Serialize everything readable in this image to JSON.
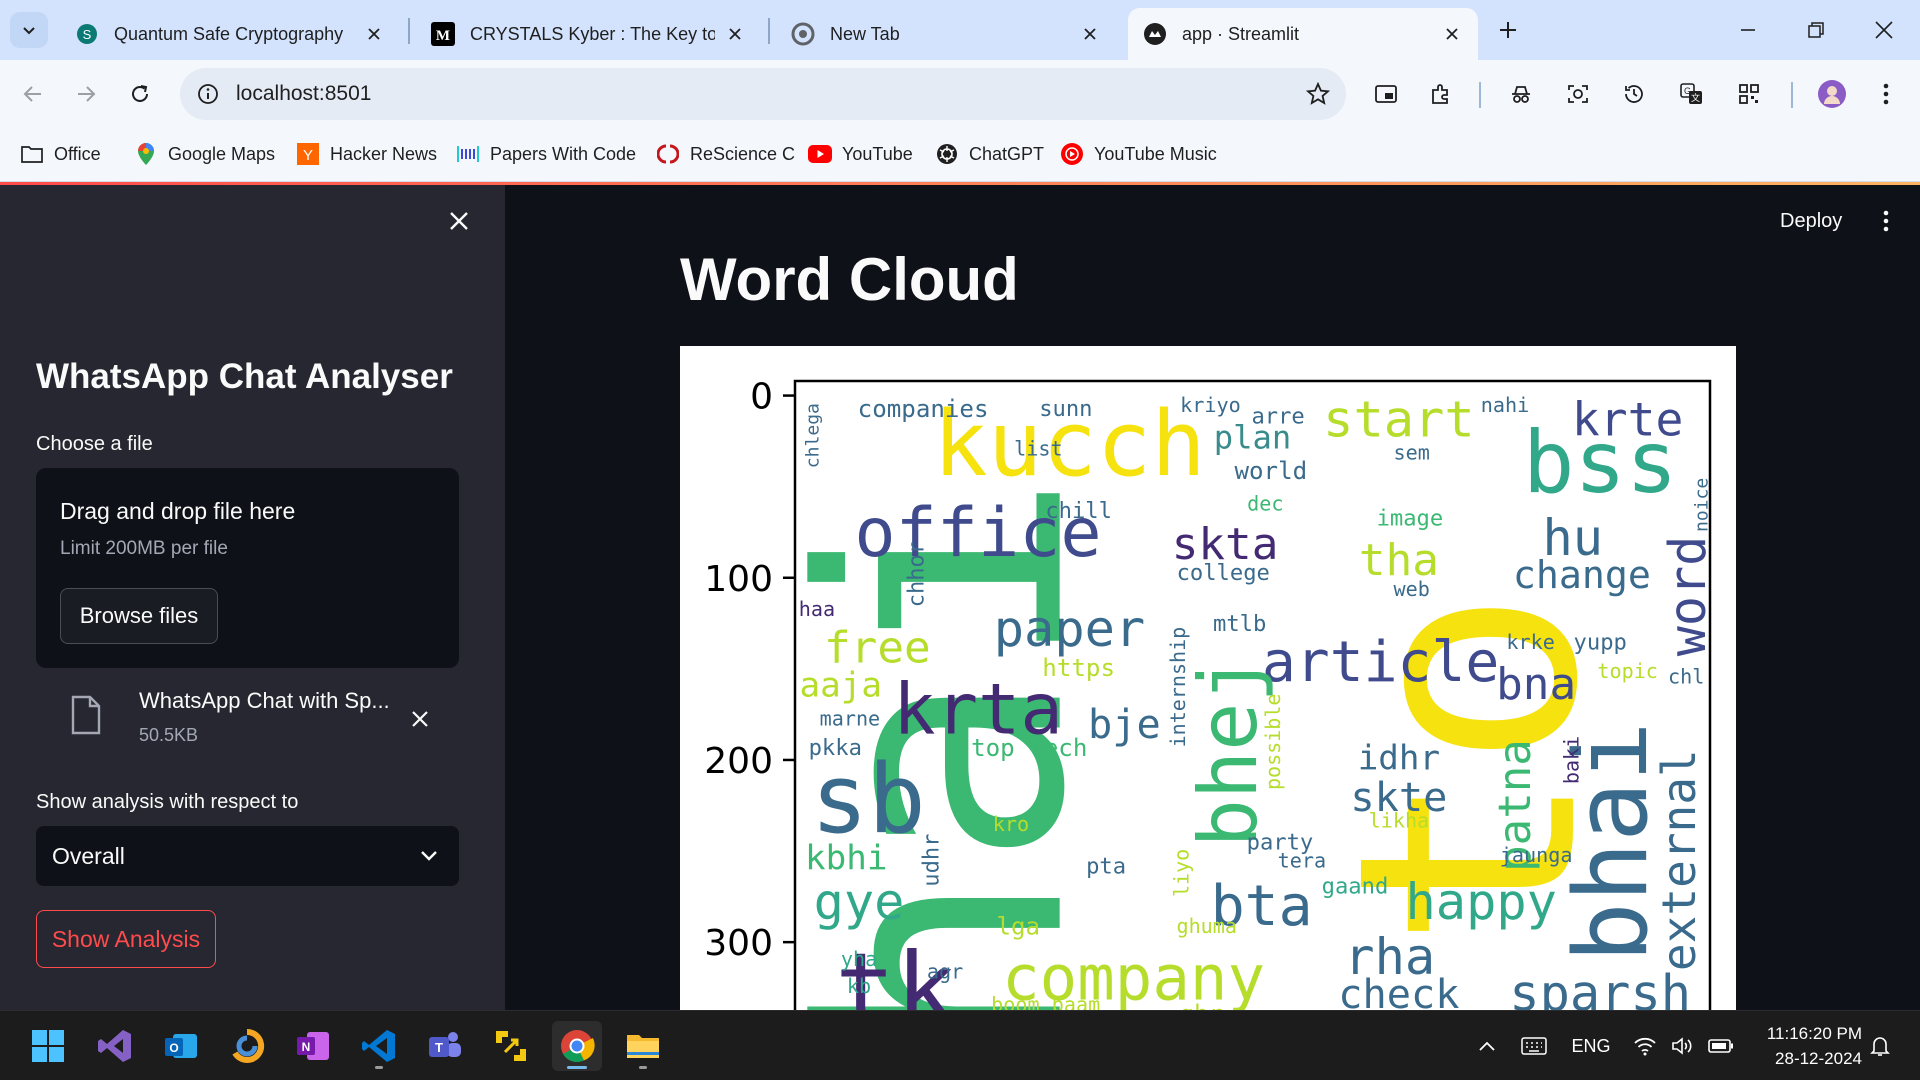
{
  "browser": {
    "tabs": [
      {
        "title": "Quantum Safe Cryptography",
        "favicon": "shield-s-icon"
      },
      {
        "title": "CRYSTALS Kyber : The Key to Po",
        "favicon": "medium-icon"
      },
      {
        "title": "New Tab",
        "favicon": "chrome-icon"
      },
      {
        "title": "app · Streamlit",
        "favicon": "streamlit-icon",
        "active": true
      }
    ],
    "url": "localhost:8501",
    "bookmarks": [
      {
        "label": "Office",
        "icon": "folder-icon"
      },
      {
        "label": "Google Maps",
        "icon": "maps-pin-icon"
      },
      {
        "label": "Hacker News",
        "icon": "hacker-news-icon"
      },
      {
        "label": "Papers With Code",
        "icon": "papers-with-code-icon"
      },
      {
        "label": "ReScience C",
        "icon": "rescience-icon"
      },
      {
        "label": "YouTube",
        "icon": "youtube-icon"
      },
      {
        "label": "ChatGPT",
        "icon": "chatgpt-icon"
      },
      {
        "label": "YouTube Music",
        "icon": "youtube-music-icon"
      }
    ]
  },
  "sidebar": {
    "title": "WhatsApp Chat Analyser",
    "file_label": "Choose a file",
    "dropzone_title": "Drag and drop file here",
    "dropzone_limit": "Limit 200MB per file",
    "browse_label": "Browse files",
    "uploaded_file": {
      "name": "WhatsApp Chat with Sp...",
      "size": "50.5KB"
    },
    "select_label": "Show analysis with respect to",
    "select_value": "Overall",
    "show_button": "Show Analysis"
  },
  "main": {
    "deploy_label": "Deploy",
    "title": "Word Cloud"
  },
  "chart_data": {
    "type": "wordcloud",
    "y_ticks": [
      "0",
      "100",
      "200",
      "300"
    ],
    "ylim": [
      0,
      340
    ],
    "xlim": [
      0,
      500
    ],
    "words": [
      {
        "text": "hai",
        "x": 95,
        "y": 205,
        "size": 330,
        "color": "#3bb872",
        "rot": -90
      },
      {
        "text": "to",
        "x": 380,
        "y": 205,
        "size": 300,
        "color": "#f5e20f",
        "rot": -90
      },
      {
        "text": "kucch",
        "x": 150,
        "y": 30,
        "size": 90,
        "color": "#f5e20f",
        "rot": 0
      },
      {
        "text": "bss",
        "x": 440,
        "y": 40,
        "size": 85,
        "color": "#31a88a",
        "rot": 0
      },
      {
        "text": "office",
        "x": 100,
        "y": 78,
        "size": 68,
        "color": "#3f4b8c",
        "rot": 0
      },
      {
        "text": "krte",
        "x": 455,
        "y": 15,
        "size": 46,
        "color": "#3f4b8c",
        "rot": 0
      },
      {
        "text": "start",
        "x": 330,
        "y": 15,
        "size": 50,
        "color": "#b6dd2b",
        "rot": 0
      },
      {
        "text": "plan",
        "x": 250,
        "y": 24,
        "size": 32,
        "color": "#3a8c8c",
        "rot": 0
      },
      {
        "text": "world",
        "x": 260,
        "y": 42,
        "size": 24,
        "color": "#3a6a8c",
        "rot": 0
      },
      {
        "text": "skta",
        "x": 235,
        "y": 83,
        "size": 44,
        "color": "#432a73",
        "rot": 0
      },
      {
        "text": "tha",
        "x": 330,
        "y": 92,
        "size": 44,
        "color": "#b6dd2b",
        "rot": 0
      },
      {
        "text": "hu",
        "x": 425,
        "y": 80,
        "size": 50,
        "color": "#3a6a8c",
        "rot": 0
      },
      {
        "text": "change",
        "x": 430,
        "y": 100,
        "size": 38,
        "color": "#3a6a8c",
        "rot": 0
      },
      {
        "text": "word",
        "x": 490,
        "y": 110,
        "size": 50,
        "color": "#3f4b8c",
        "rot": -90
      },
      {
        "text": "paper",
        "x": 150,
        "y": 130,
        "size": 50,
        "color": "#3a6a8c",
        "rot": 0
      },
      {
        "text": "free",
        "x": 45,
        "y": 140,
        "size": 44,
        "color": "#b6dd2b",
        "rot": 0
      },
      {
        "text": "article",
        "x": 320,
        "y": 148,
        "size": 56,
        "color": "#3f4b8c",
        "rot": 0
      },
      {
        "text": "bna",
        "x": 405,
        "y": 160,
        "size": 44,
        "color": "#3f4b8c",
        "rot": 0
      },
      {
        "text": "bhej",
        "x": 240,
        "y": 195,
        "size": 80,
        "color": "#3bb872",
        "rot": -90
      },
      {
        "text": "krta",
        "x": 100,
        "y": 175,
        "size": 70,
        "color": "#432a73",
        "rot": 0
      },
      {
        "text": "bje",
        "x": 180,
        "y": 182,
        "size": 40,
        "color": "#3a6a8c",
        "rot": 0
      },
      {
        "text": "aaja",
        "x": 25,
        "y": 160,
        "size": 34,
        "color": "#b6dd2b",
        "rot": 0
      },
      {
        "text": "sb",
        "x": 40,
        "y": 225,
        "size": 95,
        "color": "#3a6a8c",
        "rot": 0
      },
      {
        "text": "idhr",
        "x": 330,
        "y": 200,
        "size": 34,
        "color": "#3a6a8c",
        "rot": 0
      },
      {
        "text": "skte",
        "x": 330,
        "y": 222,
        "size": 40,
        "color": "#3a6a8c",
        "rot": 0
      },
      {
        "text": "patna",
        "x": 395,
        "y": 225,
        "size": 44,
        "color": "#3bb872",
        "rot": -90
      },
      {
        "text": "bhai",
        "x": 450,
        "y": 245,
        "size": 100,
        "color": "#3a6a8c",
        "rot": -90
      },
      {
        "text": "external",
        "x": 485,
        "y": 255,
        "size": 46,
        "color": "#3a6a8c",
        "rot": -90
      },
      {
        "text": "kbhi",
        "x": 28,
        "y": 255,
        "size": 34,
        "color": "#3bb872",
        "rot": 0
      },
      {
        "text": "gye",
        "x": 35,
        "y": 280,
        "size": 50,
        "color": "#31a88a",
        "rot": 0
      },
      {
        "text": "bta",
        "x": 255,
        "y": 282,
        "size": 56,
        "color": "#3a6a8c",
        "rot": 0
      },
      {
        "text": "happy",
        "x": 375,
        "y": 280,
        "size": 50,
        "color": "#31a88a",
        "rot": 0
      },
      {
        "text": "tk",
        "x": 55,
        "y": 330,
        "size": 100,
        "color": "#432a73",
        "rot": 0
      },
      {
        "text": "company",
        "x": 185,
        "y": 322,
        "size": 62,
        "color": "#b6dd2b",
        "rot": 0
      },
      {
        "text": "rha",
        "x": 325,
        "y": 310,
        "size": 50,
        "color": "#3a6a8c",
        "rot": 0
      },
      {
        "text": "check",
        "x": 330,
        "y": 330,
        "size": 40,
        "color": "#3a6a8c",
        "rot": 0
      },
      {
        "text": "sparsh",
        "x": 440,
        "y": 330,
        "size": 50,
        "color": "#3a6a8c",
        "rot": 0
      },
      {
        "text": "companies",
        "x": 70,
        "y": 8,
        "size": 24,
        "color": "#3a6a8c",
        "rot": 0
      },
      {
        "text": "sunn",
        "x": 148,
        "y": 8,
        "size": 22,
        "color": "#3a6a8c",
        "rot": 0
      },
      {
        "text": "kriyo",
        "x": 227,
        "y": 6,
        "size": 20,
        "color": "#3a6a8c",
        "rot": 0
      },
      {
        "text": "arre",
        "x": 264,
        "y": 12,
        "size": 22,
        "color": "#3a6a8c",
        "rot": 0
      },
      {
        "text": "nahi",
        "x": 388,
        "y": 6,
        "size": 20,
        "color": "#3a6a8c",
        "rot": 0
      },
      {
        "text": "sem",
        "x": 337,
        "y": 32,
        "size": 20,
        "color": "#3a6a8c",
        "rot": 0
      },
      {
        "text": "list",
        "x": 133,
        "y": 30,
        "size": 20,
        "color": "#3a6a8c",
        "rot": 0
      },
      {
        "text": "chlega",
        "x": 10,
        "y": 22,
        "size": 18,
        "color": "#3a6a8c",
        "rot": -90
      },
      {
        "text": "chill",
        "x": 155,
        "y": 64,
        "size": 22,
        "color": "#3a6a8c",
        "rot": 0
      },
      {
        "text": "dec",
        "x": 257,
        "y": 60,
        "size": 20,
        "color": "#3bb872",
        "rot": 0
      },
      {
        "text": "image",
        "x": 336,
        "y": 68,
        "size": 22,
        "color": "#3bb872",
        "rot": 0
      },
      {
        "text": "noice",
        "x": 496,
        "y": 60,
        "size": 18,
        "color": "#3a6a8c",
        "rot": -90
      },
      {
        "text": "college",
        "x": 234,
        "y": 98,
        "size": 22,
        "color": "#3a6a8c",
        "rot": 0
      },
      {
        "text": "web",
        "x": 337,
        "y": 107,
        "size": 20,
        "color": "#3a6a8c",
        "rot": 0
      },
      {
        "text": "chhor",
        "x": 67,
        "y": 98,
        "size": 22,
        "color": "#3a6a8c",
        "rot": -90
      },
      {
        "text": "haa",
        "x": 12,
        "y": 118,
        "size": 20,
        "color": "#432a73",
        "rot": 0
      },
      {
        "text": "mtlb",
        "x": 243,
        "y": 126,
        "size": 22,
        "color": "#3a6a8c",
        "rot": 0
      },
      {
        "text": "https",
        "x": 155,
        "y": 150,
        "size": 24,
        "color": "#b6dd2b",
        "rot": 0
      },
      {
        "text": "internship",
        "x": 210,
        "y": 160,
        "size": 20,
        "color": "#3a6a8c",
        "rot": -90
      },
      {
        "text": "krke",
        "x": 402,
        "y": 136,
        "size": 20,
        "color": "#3a6a8c",
        "rot": 0
      },
      {
        "text": "yupp",
        "x": 440,
        "y": 136,
        "size": 22,
        "color": "#3a6a8c",
        "rot": 0
      },
      {
        "text": "topic",
        "x": 455,
        "y": 152,
        "size": 20,
        "color": "#b6dd2b",
        "rot": 0
      },
      {
        "text": "chl",
        "x": 487,
        "y": 155,
        "size": 20,
        "color": "#3a6a8c",
        "rot": 0
      },
      {
        "text": "marne",
        "x": 30,
        "y": 178,
        "size": 20,
        "color": "#3a6a8c",
        "rot": 0
      },
      {
        "text": "pkka",
        "x": 22,
        "y": 194,
        "size": 22,
        "color": "#3a6a8c",
        "rot": 0
      },
      {
        "text": "top tech",
        "x": 128,
        "y": 194,
        "size": 24,
        "color": "#3bb872",
        "rot": 0
      },
      {
        "text": "possible",
        "x": 262,
        "y": 190,
        "size": 20,
        "color": "#b6dd2b",
        "rot": -90
      },
      {
        "text": "baki",
        "x": 425,
        "y": 200,
        "size": 20,
        "color": "#432a73",
        "rot": -90
      },
      {
        "text": "likha",
        "x": 330,
        "y": 234,
        "size": 20,
        "color": "#b6dd2b",
        "rot": 0
      },
      {
        "text": "kro",
        "x": 118,
        "y": 236,
        "size": 20,
        "color": "#b6dd2b",
        "rot": 0
      },
      {
        "text": "udhr",
        "x": 75,
        "y": 255,
        "size": 22,
        "color": "#3a6a8c",
        "rot": -90
      },
      {
        "text": "pta",
        "x": 170,
        "y": 259,
        "size": 22,
        "color": "#3a6a8c",
        "rot": 0
      },
      {
        "text": "party",
        "x": 265,
        "y": 246,
        "size": 22,
        "color": "#3a6a8c",
        "rot": 0
      },
      {
        "text": "liyo",
        "x": 212,
        "y": 262,
        "size": 20,
        "color": "#b6dd2b",
        "rot": -90
      },
      {
        "text": "tera",
        "x": 277,
        "y": 256,
        "size": 20,
        "color": "#3a6a8c",
        "rot": 0
      },
      {
        "text": "jaunga",
        "x": 405,
        "y": 253,
        "size": 20,
        "color": "#3a6a8c",
        "rot": 0
      },
      {
        "text": "gaand",
        "x": 306,
        "y": 270,
        "size": 22,
        "color": "#31a88a",
        "rot": 0
      },
      {
        "text": "lga",
        "x": 122,
        "y": 292,
        "size": 24,
        "color": "#b6dd2b",
        "rot": 0
      },
      {
        "text": "ghuma",
        "x": 225,
        "y": 292,
        "size": 20,
        "color": "#b6dd2b",
        "rot": 0
      },
      {
        "text": "yha",
        "x": 35,
        "y": 310,
        "size": 20,
        "color": "#31a88a",
        "rot": 0
      },
      {
        "text": "agr",
        "x": 82,
        "y": 317,
        "size": 20,
        "color": "#3a6a8c",
        "rot": 0
      },
      {
        "text": "kb",
        "x": 35,
        "y": 325,
        "size": 20,
        "color": "#31a88a",
        "rot": 0
      },
      {
        "text": "boom baam",
        "x": 137,
        "y": 335,
        "size": 20,
        "color": "#b6dd2b",
        "rot": 0
      },
      {
        "text": "ghr",
        "x": 222,
        "y": 340,
        "size": 24,
        "color": "#b6dd2b",
        "rot": 0
      }
    ]
  },
  "taskbar": {
    "apps": [
      "windows-start-icon",
      "visual-studio-icon",
      "outlook-icon",
      "app-orange-icon",
      "onenote-icon",
      "vscode-icon",
      "teams-icon",
      "file-transfer-icon",
      "chrome-icon",
      "file-explorer-icon"
    ],
    "language": "ENG",
    "time": "11:16:20 PM",
    "date": "28-12-2024"
  }
}
